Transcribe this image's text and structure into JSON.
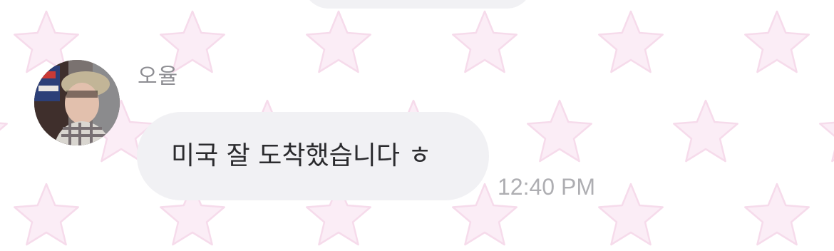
{
  "wallpaper": {
    "pattern": "star-icon",
    "color": "#fbedf6",
    "outline": "#f6dbeb"
  },
  "bubble": {
    "background": "#f1f1f4"
  },
  "message": {
    "sender": "오율",
    "text": "미국 잘 도착했습니다 ㅎ",
    "time": "12:40 PM",
    "avatar": "profile-photo"
  }
}
